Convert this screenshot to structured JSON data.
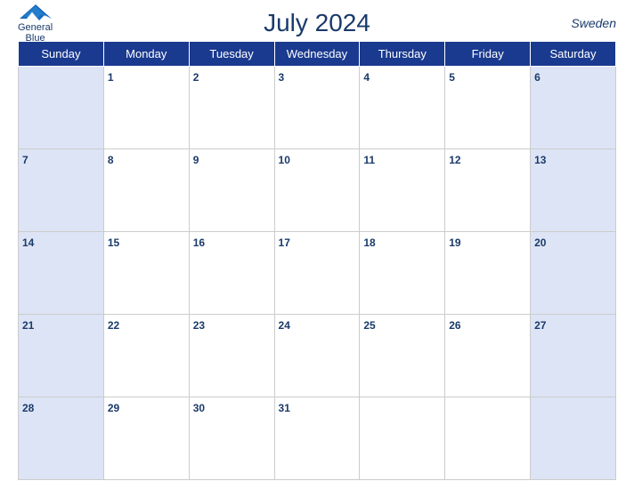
{
  "header": {
    "title": "July 2024",
    "country": "Sweden",
    "logo_line1": "General",
    "logo_line2": "Blue"
  },
  "weekdays": [
    "Sunday",
    "Monday",
    "Tuesday",
    "Wednesday",
    "Thursday",
    "Friday",
    "Saturday"
  ],
  "weeks": [
    [
      null,
      1,
      2,
      3,
      4,
      5,
      6
    ],
    [
      7,
      8,
      9,
      10,
      11,
      12,
      13
    ],
    [
      14,
      15,
      16,
      17,
      18,
      19,
      20
    ],
    [
      21,
      22,
      23,
      24,
      25,
      26,
      27
    ],
    [
      28,
      29,
      30,
      31,
      null,
      null,
      null
    ]
  ]
}
